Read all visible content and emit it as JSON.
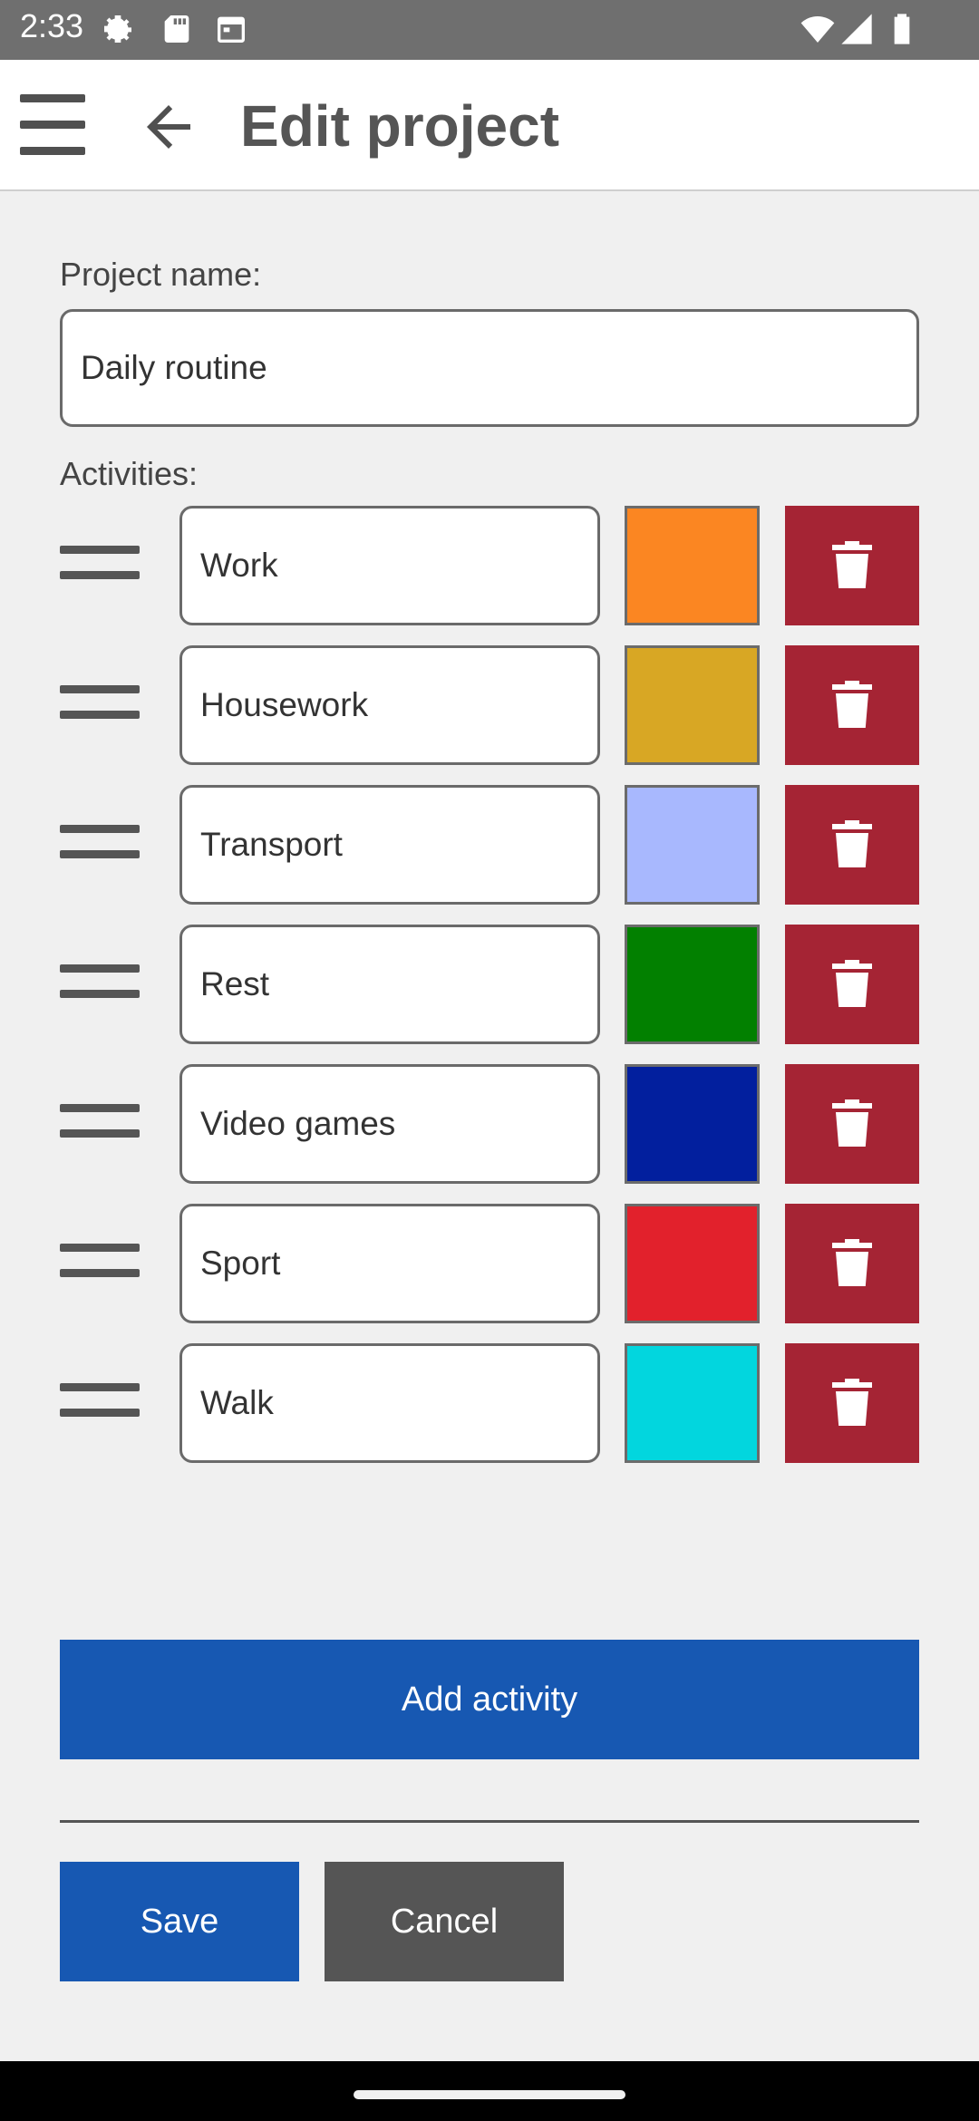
{
  "status_bar": {
    "time": "2:33",
    "left_icons": [
      "settings-gear-icon",
      "sd-card-icon",
      "calendar-icon"
    ],
    "right_icons": [
      "wifi-icon",
      "cell-signal-icon",
      "battery-icon"
    ]
  },
  "app_bar": {
    "menu_icon": "hamburger-menu-icon",
    "back_icon": "arrow-back-icon",
    "title": "Edit project"
  },
  "form": {
    "project_name_label": "Project name:",
    "project_name_value": "Daily routine",
    "activities_label": "Activities:",
    "activities": [
      {
        "name": "Work",
        "color": "#fb8622"
      },
      {
        "name": "Housework",
        "color": "#d8a724"
      },
      {
        "name": "Transport",
        "color": "#a8b8fe"
      },
      {
        "name": "Rest",
        "color": "#028000"
      },
      {
        "name": "Video games",
        "color": "#021f9e"
      },
      {
        "name": "Sport",
        "color": "#e2212c"
      },
      {
        "name": "Walk",
        "color": "#02d6de"
      }
    ],
    "delete_color": "#a52434"
  },
  "buttons": {
    "add_activity": "Add activity",
    "save": "Save",
    "cancel": "Cancel"
  },
  "colors": {
    "primary": "#1758b2",
    "secondary": "#555555"
  }
}
